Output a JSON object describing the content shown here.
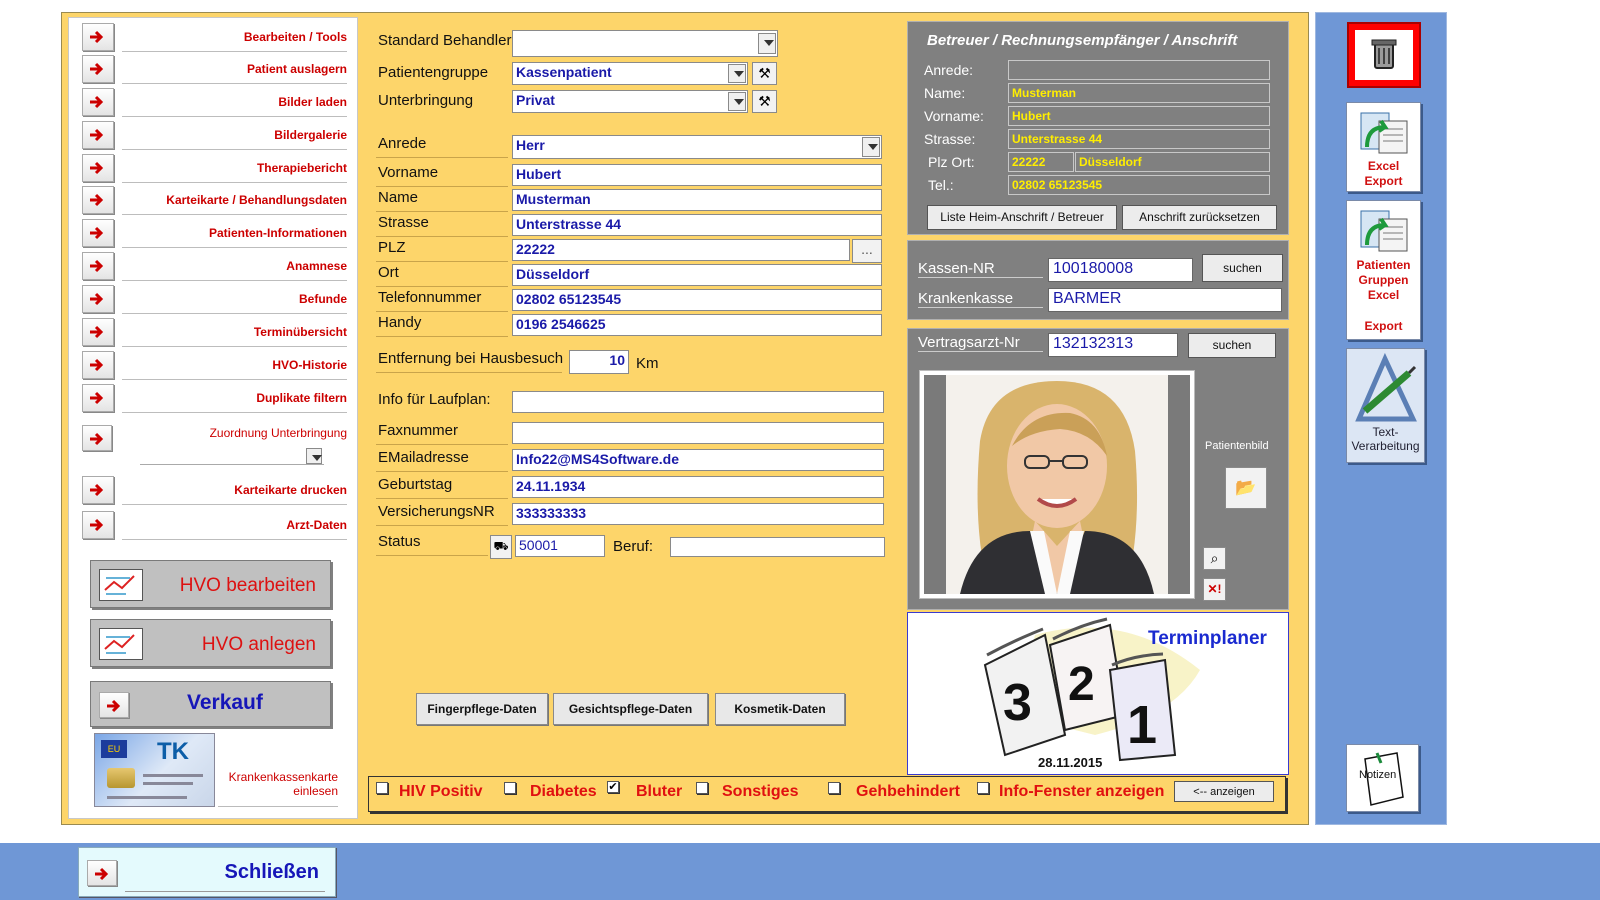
{
  "nav": {
    "items": [
      {
        "label": "Bearbeiten / Tools"
      },
      {
        "label": "Patient auslagern"
      },
      {
        "label": "Bilder laden"
      },
      {
        "label": "Bildergalerie"
      },
      {
        "label": "Therapiebericht"
      },
      {
        "label": "Karteikarte / Behandlungsdaten"
      },
      {
        "label": "Patienten-Informationen"
      },
      {
        "label": "Anamnese"
      },
      {
        "label": "Befunde"
      },
      {
        "label": "Terminübersicht"
      },
      {
        "label": "HVO-Historie"
      },
      {
        "label": "Duplikate filtern"
      }
    ],
    "zuordnung_label": "Zuordnung Unterbringung",
    "karteikarte_drucken": "Karteikarte drucken",
    "arzt_daten": "Arzt-Daten",
    "hvo_bearbeiten": "HVO bearbeiten",
    "hvo_anlegen": "HVO anlegen",
    "verkauf": "Verkauf",
    "kassenkarte_label_1": "Krankenkassenkarte",
    "kassenkarte_label_2": "einlesen",
    "card_brand": "TK",
    "card_eu": "EU"
  },
  "form": {
    "standard_behandler_label": "Standard Behandler",
    "standard_behandler_value": "",
    "patientengruppe_label": "Patientengruppe",
    "patientengruppe_value": "Kassenpatient",
    "unterbringung_label": "Unterbringung",
    "unterbringung_value": "Privat",
    "anrede_label": "Anrede",
    "anrede_value": "Herr",
    "vorname_label": "Vorname",
    "vorname_value": "Hubert",
    "name_label": "Name",
    "name_value": "Musterman",
    "strasse_label": "Strasse",
    "strasse_value": "Unterstrasse 44",
    "plz_label": "PLZ",
    "plz_value": "22222",
    "plz_more": "...",
    "ort_label": "Ort",
    "ort_value": "Düsseldorf",
    "telefon_label": "Telefonnummer",
    "telefon_value": "02802 65123545",
    "handy_label": "Handy",
    "handy_value": "0196 2546625",
    "entfernung_label": "Entfernung bei Hausbesuch",
    "entfernung_value": "10",
    "entfernung_unit": "Km",
    "laufplan_label": "Info für Laufplan:",
    "laufplan_value": "",
    "fax_label": "Faxnummer",
    "fax_value": "",
    "email_label": "EMailadresse",
    "email_value": "Info22@MS4Software.de",
    "geburtstag_label": "Geburtstag",
    "geburtstag_value": "24.11.1934",
    "versnr_label": "VersicherungsNR",
    "versnr_value": "333333333",
    "status_label": "Status",
    "status_value": "50001",
    "beruf_label": "Beruf:",
    "beruf_value": "",
    "btn_fingerpflege": "Fingerpflege-Daten",
    "btn_gesicht": "Gesichtspflege-Daten",
    "btn_kosmetik": "Kosmetik-Daten"
  },
  "betreuer": {
    "title": "Betreuer / Rechnungsempfänger / Anschrift",
    "anrede_label": "Anrede:",
    "anrede_value": "",
    "name_label": "Name:",
    "name_value": "Musterman",
    "vorname_label": "Vorname:",
    "vorname_value": "Hubert",
    "strasse_label": "Strasse:",
    "strasse_value": "Unterstrasse 44",
    "plzort_label": "Plz Ort:",
    "plz_value": "22222",
    "ort_value": "Düsseldorf",
    "tel_label": "Tel.:",
    "tel_value": "02802 65123545",
    "btn_liste": "Liste Heim-Anschrift / Betreuer",
    "btn_reset": "Anschrift zurücksetzen"
  },
  "kasse": {
    "nr_label": "Kassen-NR",
    "nr_value": "100180008",
    "suchen": "suchen",
    "kk_label": "Krankenkasse",
    "kk_value": "BARMER"
  },
  "arzt": {
    "nr_label": "Vertragsarzt-Nr",
    "nr_value": "132132313",
    "suchen": "suchen",
    "patientenbild_label": "Patientenbild"
  },
  "terminplaner": {
    "title": "Terminplaner",
    "date": "28.11.2015",
    "digits": [
      "3",
      "2",
      "1"
    ]
  },
  "flags": [
    {
      "label": "HIV Positiv",
      "checked": false
    },
    {
      "label": "Diabetes",
      "checked": false
    },
    {
      "label": "Bluter",
      "checked": true
    },
    {
      "label": "Sonstiges",
      "checked": false
    },
    {
      "label": "Gehbehindert",
      "checked": false
    },
    {
      "label": "Info-Fenster anzeigen",
      "checked": false
    }
  ],
  "anzeigen_btn": "<-- anzeigen",
  "sidebar": {
    "excel_export_1": "Excel",
    "excel_export_2": "Export",
    "pg_1": "Patienten",
    "pg_2": "Gruppen",
    "pg_3": "Excel",
    "pg_4": "Export",
    "text_1": "Text-",
    "text_2": "Verarbeitung",
    "notizen": "Notizen"
  },
  "schliessen": "Schließen",
  "colors": {
    "main_bg": "#fdd56a",
    "accent_red": "#dd1111",
    "field_text": "#1a1aa8",
    "sidebar_blue": "#6f97d6",
    "panel_gray": "#808080",
    "highlight_yellow": "#ffee00"
  }
}
